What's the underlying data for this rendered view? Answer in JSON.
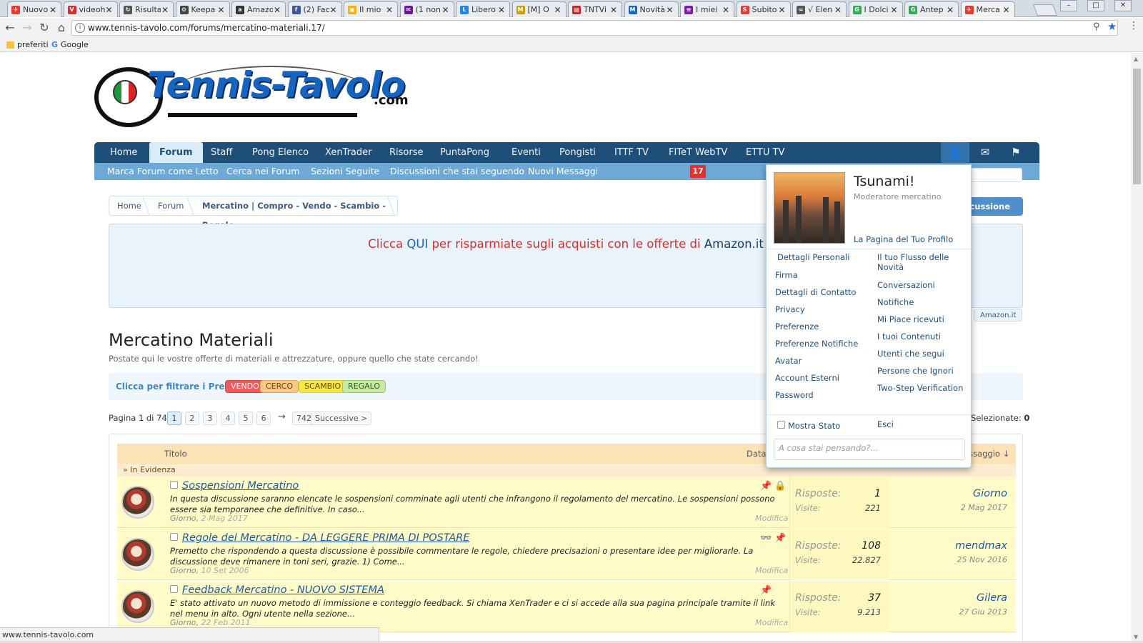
{
  "browser": {
    "tabs": [
      {
        "title": "Nuovo",
        "color": "#e53935",
        "glyph": "✈"
      },
      {
        "title": "videoh",
        "color": "#d32f2f",
        "glyph": "V"
      },
      {
        "title": "Risulta",
        "color": "#555555",
        "glyph": "↻"
      },
      {
        "title": "Keepa",
        "color": "#444444",
        "glyph": "⚙"
      },
      {
        "title": "Amazo",
        "color": "#333333",
        "glyph": "a"
      },
      {
        "title": "(2) Fac",
        "color": "#3b5998",
        "glyph": "f"
      },
      {
        "title": "Il mio",
        "color": "#f4b400",
        "glyph": "▣"
      },
      {
        "title": "(1 non",
        "color": "#6a1b9a",
        "glyph": "✉"
      },
      {
        "title": "Libero",
        "color": "#1e88e5",
        "glyph": "L"
      },
      {
        "title": "[M] O",
        "color": "#c8a000",
        "glyph": "M"
      },
      {
        "title": "TNTVi",
        "color": "#c62828",
        "glyph": "▤"
      },
      {
        "title": "Novità",
        "color": "#1565c0",
        "glyph": "M"
      },
      {
        "title": "I miei",
        "color": "#7b1fa2",
        "glyph": "≡"
      },
      {
        "title": "Subito",
        "color": "#e53935",
        "glyph": "S"
      },
      {
        "title": "√ Elen",
        "color": "#555555",
        "glyph": "∞"
      },
      {
        "title": "I Dolci",
        "color": "#34a853",
        "glyph": "G"
      },
      {
        "title": "Antep",
        "color": "#34a853",
        "glyph": "G"
      },
      {
        "title": "Merca",
        "color": "#e53935",
        "glyph": "✈"
      }
    ],
    "url": "www.tennis-tavolo.com/forums/mercatino-materiali.17/",
    "bookmarks": [
      "preferiti",
      "Google"
    ],
    "status_url": "www.tennis-tavolo.com"
  },
  "logo": {
    "word": "Tennis-Tavolo",
    "suffix": ".com"
  },
  "nav": {
    "tabs": [
      "Home",
      "Forum",
      "Staff",
      "Pong Elenco",
      "XenTrader",
      "Risorse",
      "PuntaPong",
      "Eventi",
      "Pongisti",
      "ITTF TV",
      "FITeT WebTV",
      "ETTU TV"
    ],
    "selected": "Forum",
    "sublinks": [
      "Marca Forum come Letto",
      "Cerca nei Forum",
      "Sezioni Seguite",
      "Discussioni che stai seguendo",
      "Nuovi Messaggi"
    ],
    "new_messages_count": "17"
  },
  "breadcrumb": [
    "Home",
    "Forum",
    "Mercatino | Compro - Vendo - Scambio - Regalo"
  ],
  "new_discussion_label": "Discussione",
  "ad": {
    "p1": "Clicca ",
    "p2": "QUI",
    "p3": " per risparmiate sugli acquisti con le offerte di ",
    "p4": "Amazon.it",
    "button": "Amazon.it"
  },
  "page": {
    "title": "Mercatino Materiali",
    "description": "Postate qui le vostre offerte di materiali e attrezzature, oppure quello che state cercando!",
    "prefix_label": "Clicca per filtrare i Prefissi:",
    "prefixes": [
      {
        "label": "VENDO",
        "bg": "#f05a5a",
        "fg": "#ffffff",
        "border": "#d94444"
      },
      {
        "label": "CERCO",
        "bg": "#f9c98a",
        "fg": "#6b3c06",
        "border": "#e5a858"
      },
      {
        "label": "SCAMBIO",
        "bg": "#f6e84a",
        "fg": "#5c5100",
        "border": "#d9c92a"
      },
      {
        "label": "REGALO",
        "bg": "#c8eaa8",
        "fg": "#2f5a12",
        "border": "#97cc6c"
      }
    ]
  },
  "pagination": {
    "label": "Pagina 1 di 742",
    "pages": [
      "1",
      "2",
      "3",
      "4",
      "5",
      "6"
    ],
    "arrow": "→",
    "last": "742",
    "next": "Successive >",
    "current": "1"
  },
  "selection": {
    "label": "Selezionate:",
    "count": "0"
  },
  "thread_list": {
    "col_title": "Titolo",
    "col_date": "Data d",
    "col_last": "essaggio ↓",
    "sticky_label": "» In Evidenza",
    "threads": [
      {
        "title": "Sospensioni Mercatino",
        "snippet": "In questa discussione saranno elencate le sospensioni comminate agli utenti che infrangono il regolamento del mercatino. Le sospensioni possono essere sia temporanee che definitive. In caso...",
        "author": "Giorno",
        "date": "2 Mag 2017",
        "edit": "Modifica",
        "icons": [
          "pin-icon",
          "lock-icon"
        ],
        "replies_label": "Risposte:",
        "replies": "1",
        "views_label": "Visite:",
        "views": "221",
        "last_user": "Giorno",
        "last_date": "2 Mag 2017"
      },
      {
        "title": "Regole del Mercatino - DA LEGGERE PRIMA DI POSTARE",
        "snippet": "Premetto che rispondendo a questa discussione è possibile commentare le regole, chiedere precisazioni o presentare idee per migliorarle. La discussione deve rimanere in toni seri, grazie. 1) Come...",
        "author": "Giorno",
        "date": "10 Set 2006",
        "edit": "Modifica",
        "icons": [
          "glasses-icon",
          "pin-icon"
        ],
        "replies_label": "Risposte:",
        "replies": "108",
        "views_label": "Visite:",
        "views": "22.827",
        "last_user": "mendmax",
        "last_date": "25 Nov 2016"
      },
      {
        "title": "Feedback Mercatino - NUOVO SISTEMA",
        "snippet": "E' stato attivato un nuovo metodo di immissione e conteggio feedback. Si chiama XenTrader e ci si accede alla sua pagina principale tramite il link nel menu in alto. Ogni utente nella sezione...",
        "author": "Giorno",
        "date": "22 Feb 2011",
        "edit": "Modifica",
        "icons": [
          "pin-icon"
        ],
        "replies_label": "Risposte:",
        "replies": "37",
        "views_label": "Visite:",
        "views": "9.213",
        "last_user": "Gilera",
        "last_date": "27 Giu 2013"
      }
    ]
  },
  "account_popup": {
    "username": "Tsunami!",
    "role": "Moderatore mercatino",
    "profile_link": "La Pagina del Tuo Profilo",
    "left_links": [
      "Dettagli Personali",
      "Firma",
      "Dettagli di Contatto",
      "Privacy",
      "Preferenze",
      "Preferenze Notifiche",
      "Avatar",
      "Account Esterni",
      "Password"
    ],
    "right_links": [
      "Il tuo Flusso delle Novità",
      "Conversazioni",
      "Notifiche",
      "Mi Piace ricevuti",
      "I tuoi Contenuti",
      "Utenti che segui",
      "Persone che Ignori",
      "Two-Step Verification"
    ],
    "show_status": "Mostra Stato",
    "logout": "Esci",
    "status_placeholder": "A cosa stai pensando?..."
  }
}
